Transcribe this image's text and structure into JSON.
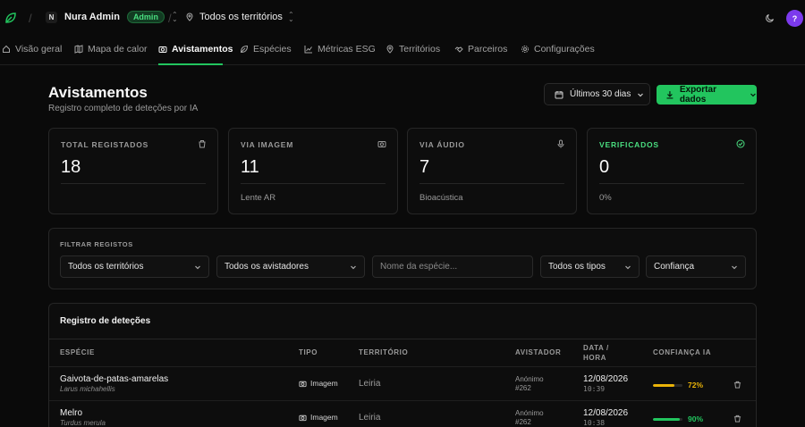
{
  "topbar": {
    "org_initial": "N",
    "org_name": "Nura Admin",
    "role_badge": "Admin",
    "territory_selector": "Todos os territórios",
    "avatar_initial": "?"
  },
  "nav": {
    "items": [
      {
        "label": "Visão geral",
        "icon": "home-icon"
      },
      {
        "label": "Mapa de calor",
        "icon": "map-icon"
      },
      {
        "label": "Avistamentos",
        "icon": "camera-icon",
        "active": true
      },
      {
        "label": "Espécies",
        "icon": "leaf-icon"
      },
      {
        "label": "Métricas ESG",
        "icon": "chart-icon"
      },
      {
        "label": "Territórios",
        "icon": "pin-icon"
      },
      {
        "label": "Parceiros",
        "icon": "handshake-icon"
      },
      {
        "label": "Configurações",
        "icon": "gear-icon"
      }
    ]
  },
  "header": {
    "title": "Avistamentos",
    "subtitle": "Registro completo de deteções por IA",
    "range_label": "Últimos 30 dias",
    "export_label": "Exportar dados"
  },
  "stats": [
    {
      "label": "TOTAL REGISTADOS",
      "value": "18",
      "footer": "",
      "icon": "trash-icon"
    },
    {
      "label": "VIA IMAGEM",
      "value": "11",
      "footer": "Lente AR",
      "icon": "camera-icon"
    },
    {
      "label": "VIA ÁUDIO",
      "value": "7",
      "footer": "Bioacústica",
      "icon": "mic-icon"
    },
    {
      "label": "VERIFICADOS",
      "value": "0",
      "footer": "0%",
      "icon": "check-circle-icon"
    }
  ],
  "filters": {
    "label": "FILTRAR REGISTOS",
    "territory": "Todos os territórios",
    "observers": "Todos os avistadores",
    "species_placeholder": "Nome da espécie...",
    "types": "Todos os tipos",
    "confidence": "Confiança"
  },
  "table": {
    "title": "Registro de deteções",
    "headers": {
      "species": "ESPÉCIE",
      "type": "TIPO",
      "territory": "TERRITÓRIO",
      "observer": "AVISTADOR",
      "datetime_1": "DATA /",
      "datetime_2": "HORA",
      "confidence": "CONFIANÇA IA"
    },
    "rows": [
      {
        "common": "Gaivota-de-patas-amarelas",
        "scientific": "Larus michahellis",
        "type": "Imagem",
        "territory": "Leiria",
        "observer_1": "Anónimo",
        "observer_2": "#262",
        "date": "12/08/2026",
        "time": "10:39",
        "confidence": "72%",
        "confidence_value": 0.72,
        "bar_color": "#eab308",
        "text_color": "#eab308"
      },
      {
        "common": "Melro",
        "scientific": "Turdus merula",
        "type": "Imagem",
        "territory": "Leiria",
        "observer_1": "Anónimo",
        "observer_2": "#262",
        "date": "12/08/2026",
        "time": "10:38",
        "confidence": "90%",
        "confidence_value": 0.9,
        "bar_color": "#22c55e",
        "text_color": "#22c55e"
      }
    ]
  },
  "colors": {
    "accent": "#22c55e",
    "verified": "#4ade80",
    "avatar": "#7c3aed"
  }
}
